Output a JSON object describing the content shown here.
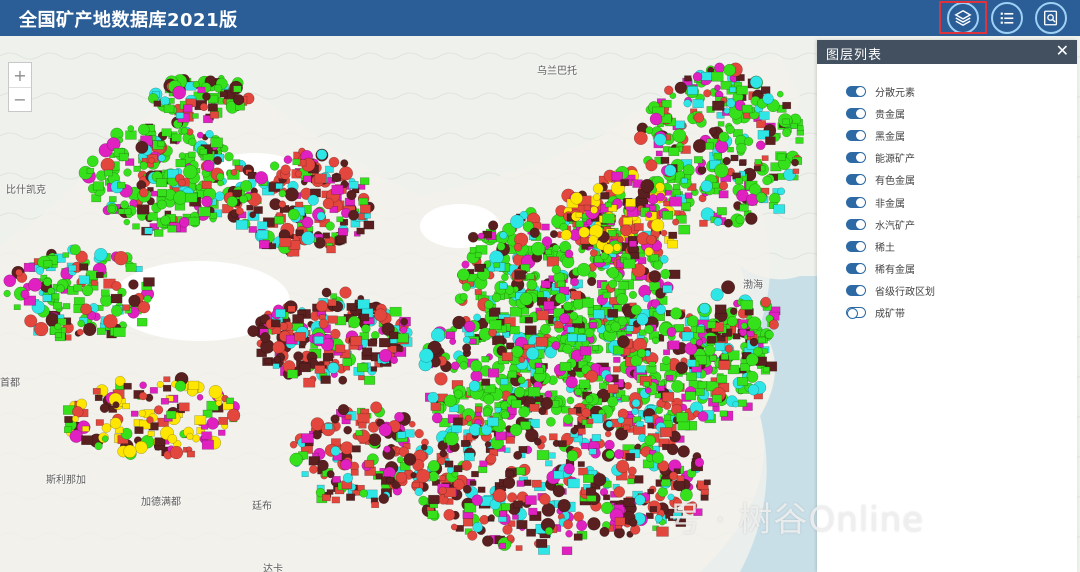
{
  "header": {
    "title": "全国矿产地数据库2021版",
    "tools": [
      {
        "name": "layers",
        "icon": "layers-icon"
      },
      {
        "name": "list",
        "icon": "list-icon"
      },
      {
        "name": "search",
        "icon": "search-doc-icon"
      }
    ]
  },
  "zoom": {
    "in": "+",
    "out": "−"
  },
  "map_labels": {
    "mongolia": "乌兰巴托",
    "kazakh": "比什凯克",
    "bohai": "渤海",
    "west": "斯利那加",
    "nepal": "加德满都",
    "bhutan": "廷布",
    "dhaka": "达卡",
    "west2": "首都"
  },
  "panel": {
    "title": "图层列表",
    "close": "✕",
    "layers": [
      {
        "label": "分散元素",
        "on": true
      },
      {
        "label": "贵金属",
        "on": true
      },
      {
        "label": "黑金属",
        "on": true
      },
      {
        "label": "能源矿产",
        "on": true
      },
      {
        "label": "有色金属",
        "on": true
      },
      {
        "label": "非金属",
        "on": true
      },
      {
        "label": "水汽矿产",
        "on": true
      },
      {
        "label": "稀土",
        "on": true
      },
      {
        "label": "稀有金属",
        "on": true
      },
      {
        "label": "省级行政区划",
        "on": true
      },
      {
        "label": "成矿带",
        "on": false
      }
    ]
  },
  "watermark": "号 · 树谷Online",
  "colors": {
    "header": "#2b5e97",
    "panel_header": "#42505f",
    "toggle": "#2d6aa5",
    "marker_green": "#35e11a",
    "marker_brown": "#5a1f1f",
    "marker_red": "#e2463c",
    "marker_magenta": "#e020c0",
    "marker_cyan": "#2fe6e6"
  }
}
